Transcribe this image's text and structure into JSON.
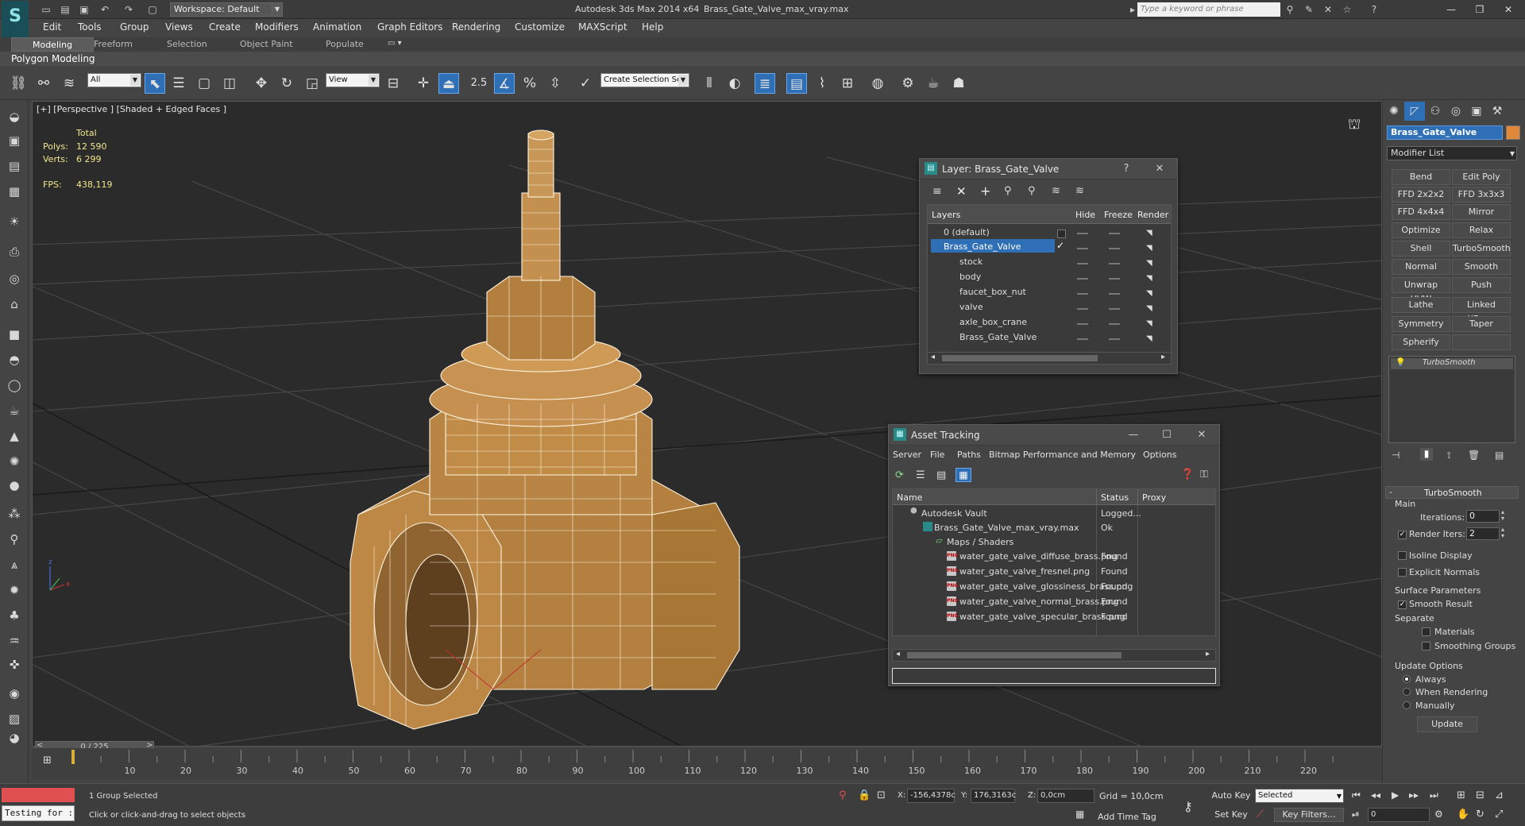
{
  "window": {
    "app_title": "Autodesk 3ds Max  2014 x64",
    "file_title": "Brass_Gate_Valve_max_vray.max",
    "workspace": "Workspace: Default",
    "search_placeholder": "Type a keyword or phrase"
  },
  "menu": [
    "Edit",
    "Tools",
    "Group",
    "Views",
    "Create",
    "Modifiers",
    "Animation",
    "Graph Editors",
    "Rendering",
    "Customize",
    "MAXScript",
    "Help"
  ],
  "ribbon": {
    "tabs": [
      "Modeling",
      "Freeform",
      "Selection",
      "Object Paint",
      "Populate"
    ],
    "active_tab": "Modeling",
    "panel_label": "Polygon Modeling"
  },
  "toolbar": {
    "filter_value": "All",
    "refcoord_value": "View",
    "snap_value": "2.5",
    "named_selection_placeholder": "Create Selection Se"
  },
  "viewport": {
    "label": "[+] [Perspective ] [Shaded + Edged Faces ]",
    "stats": {
      "total_label": "Total",
      "polys_label": "Polys:",
      "polys_value": "12 590",
      "verts_label": "Verts:",
      "verts_value": "6 299",
      "fps_label": "FPS:",
      "fps_value": "438,119"
    }
  },
  "layer_window": {
    "title": "Layer: Brass_Gate_Valve",
    "columns": [
      "Layers",
      "Hide",
      "Freeze",
      "Render"
    ],
    "rows": [
      {
        "name": "0 (default)",
        "level": 0,
        "selected": false
      },
      {
        "name": "Brass_Gate_Valve",
        "level": 0,
        "selected": true
      },
      {
        "name": "stock",
        "level": 1,
        "selected": false
      },
      {
        "name": "body",
        "level": 1,
        "selected": false
      },
      {
        "name": "faucet_box_nut",
        "level": 1,
        "selected": false
      },
      {
        "name": "valve",
        "level": 1,
        "selected": false
      },
      {
        "name": "axle_box_crane",
        "level": 1,
        "selected": false
      },
      {
        "name": "Brass_Gate_Valve",
        "level": 1,
        "selected": false
      }
    ]
  },
  "asset_window": {
    "title": "Asset Tracking",
    "menu": [
      "Server",
      "File",
      "Paths",
      "Bitmap Performance and Memory",
      "Options"
    ],
    "columns": [
      "Name",
      "Status",
      "Proxy"
    ],
    "rows": [
      {
        "name": "Autodesk Vault",
        "status": "Logged...",
        "level": 0
      },
      {
        "name": "Brass_Gate_Valve_max_vray.max",
        "status": "Ok",
        "level": 1
      },
      {
        "name": "Maps / Shaders",
        "status": "",
        "level": 2
      },
      {
        "name": "water_gate_valve_diffuse_brass.png",
        "status": "Found",
        "level": 3
      },
      {
        "name": "water_gate_valve_fresnel.png",
        "status": "Found",
        "level": 3
      },
      {
        "name": "water_gate_valve_glossiness_brass.png",
        "status": "Found",
        "level": 3
      },
      {
        "name": "water_gate_valve_normal_brass.png",
        "status": "Found",
        "level": 3
      },
      {
        "name": "water_gate_valve_specular_brass.png",
        "status": "Found",
        "level": 3
      }
    ]
  },
  "command_panel": {
    "object_name": "Brass_Gate_Valve",
    "object_color": "#e0883a",
    "modifier_list_label": "Modifier List",
    "modifiers": [
      "Bend",
      "Edit Poly",
      "FFD 2x2x2",
      "FFD 3x3x3",
      "FFD 4x4x4",
      "Mirror",
      "Optimize",
      "Relax",
      "Shell",
      "TurboSmooth",
      "Normal",
      "Smooth",
      "Unwrap UVW",
      "Push",
      "Lathe",
      "Linked XForm",
      "Symmetry",
      "Taper",
      "Spherify",
      ""
    ],
    "stack_item": "TurboSmooth",
    "rollout_title": "TurboSmooth",
    "main_label": "Main",
    "iterations_label": "Iterations:",
    "iterations_value": "0",
    "render_iters_label": "Render Iters:",
    "render_iters_value": "2",
    "isoline_label": "Isoline Display",
    "explicit_normals_label": "Explicit Normals",
    "surface_params_label": "Surface Parameters",
    "smooth_result_label": "Smooth Result",
    "separate_label": "Separate",
    "materials_label": "Materials",
    "smoothing_groups_label": "Smoothing Groups",
    "update_options_label": "Update Options",
    "always_label": "Always",
    "when_rendering_label": "When Rendering",
    "manually_label": "Manually",
    "update_button": "Update"
  },
  "timeline": {
    "slider_text": "0 / 225",
    "ticks": [
      "10",
      "20",
      "30",
      "40",
      "50",
      "60",
      "70",
      "80",
      "90",
      "100",
      "110",
      "120",
      "130",
      "140",
      "150",
      "160",
      "170",
      "180",
      "190",
      "200",
      "210",
      "220"
    ]
  },
  "status": {
    "script_text": "Testing for :",
    "selection_text": "1 Group Selected",
    "prompt_text": "Click or click-and-drag to select objects",
    "x_label": "X:",
    "x_value": "-156,4378c",
    "y_label": "Y:",
    "y_value": "176,3163c",
    "z_label": "Z:",
    "z_value": "0,0cm",
    "grid_text": "Grid = 10,0cm",
    "add_time_tag": "Add Time Tag",
    "auto_key": "Auto Key",
    "set_key": "Set Key",
    "selected_value": "Selected",
    "key_filters": "Key Filters...",
    "frame_value": "0"
  }
}
